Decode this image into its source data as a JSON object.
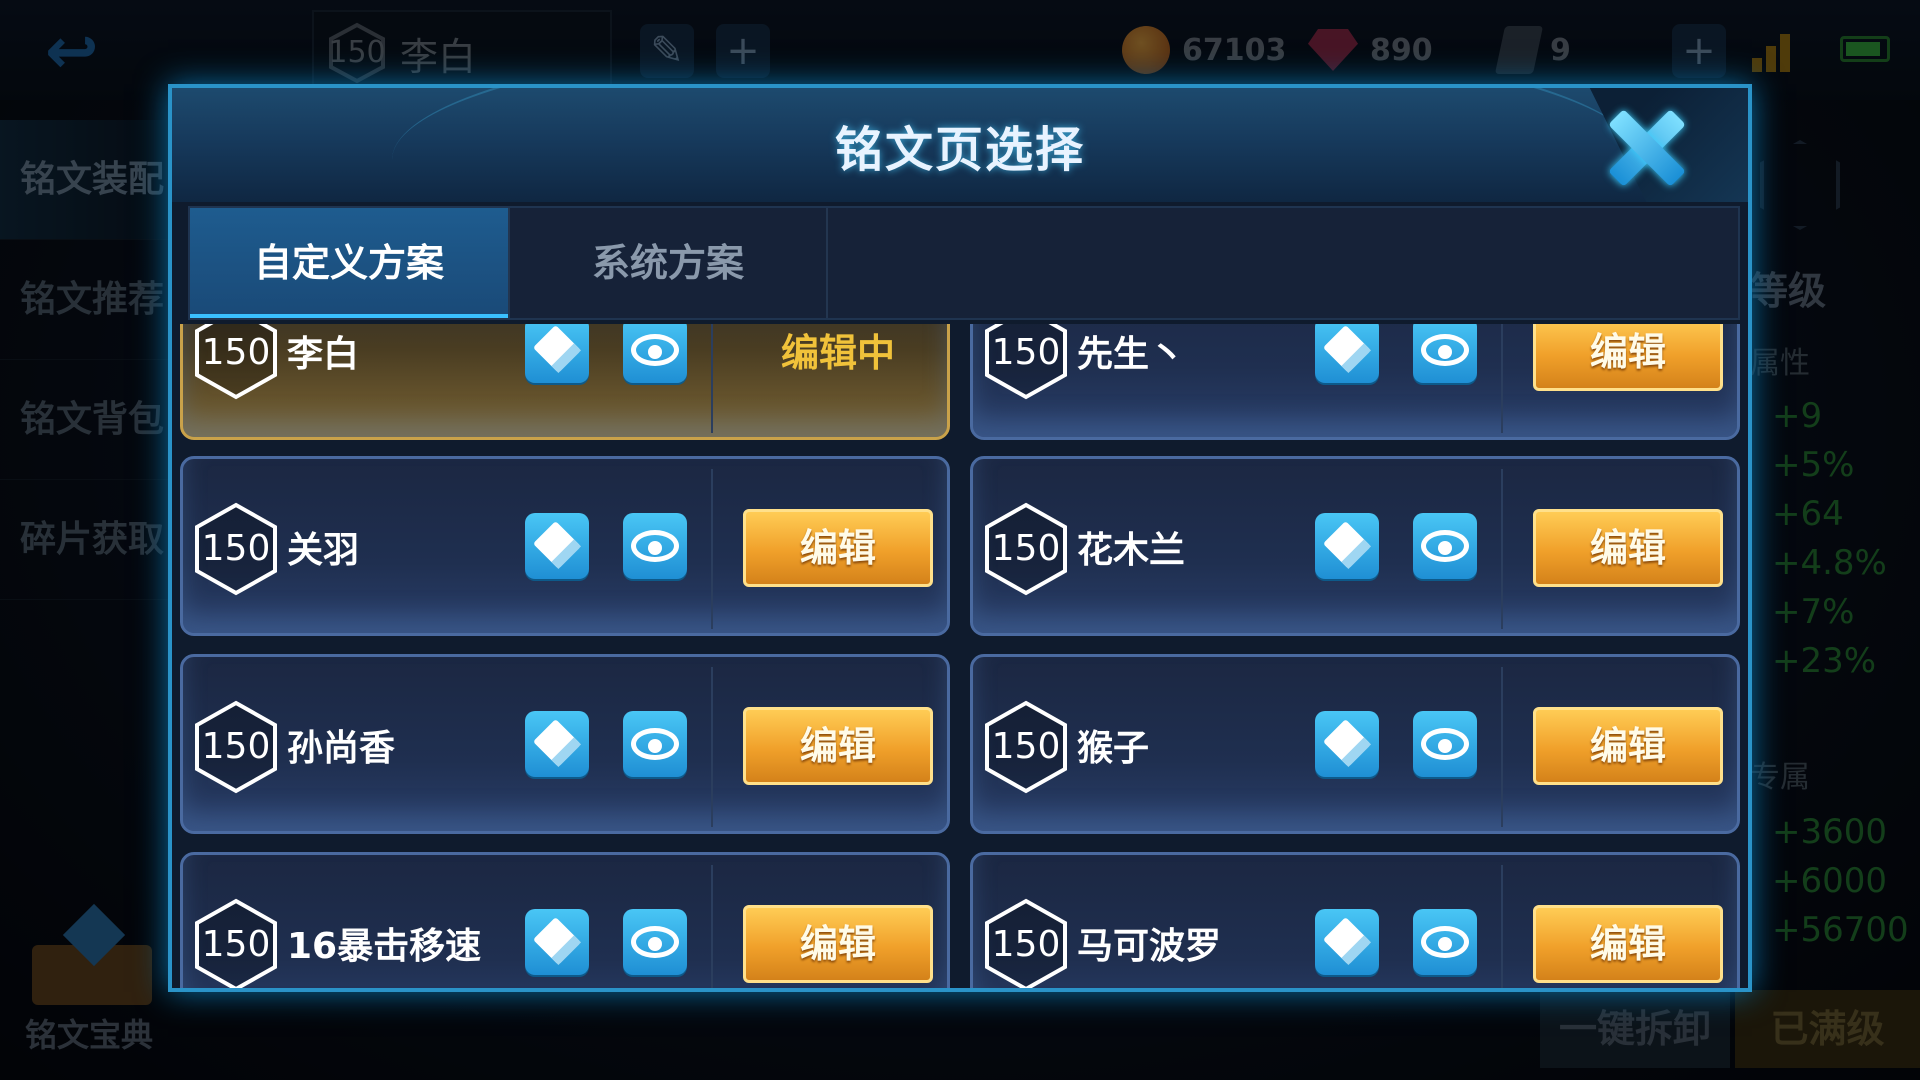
{
  "top_bar": {
    "hero_level": "150",
    "hero_name": "李白",
    "gold": "67103",
    "diamonds": "890",
    "tickets": "9"
  },
  "left_nav": {
    "items": [
      "铭文装配",
      "铭文推荐",
      "铭文背包",
      "碎片获取"
    ],
    "codex_label": "铭文宝典"
  },
  "right_panel": {
    "title": "等级",
    "section1": "属性",
    "stats1": [
      "+9",
      "+5%",
      "+64",
      "+4.8%",
      "+7%",
      "+23%"
    ],
    "section2": "专属",
    "stats2": [
      "+3600",
      "+6000",
      "+56700"
    ],
    "unload_all": "一键拆卸",
    "maxed": "已满级"
  },
  "modal": {
    "title": "铭文页选择",
    "tabs": [
      "自定义方案",
      "系统方案"
    ],
    "editing_label": "编辑中",
    "edit_label": "编辑",
    "pages": [
      {
        "level": "150",
        "name": "李白",
        "editing": true
      },
      {
        "level": "150",
        "name": "先生丶",
        "editing": false
      },
      {
        "level": "150",
        "name": "关羽",
        "editing": false
      },
      {
        "level": "150",
        "name": "花木兰",
        "editing": false
      },
      {
        "level": "150",
        "name": "孙尚香",
        "editing": false
      },
      {
        "level": "150",
        "name": "猴子",
        "editing": false
      },
      {
        "level": "150",
        "name": "16暴击移速",
        "editing": false
      },
      {
        "level": "150",
        "name": "马可波罗",
        "editing": false
      }
    ]
  }
}
